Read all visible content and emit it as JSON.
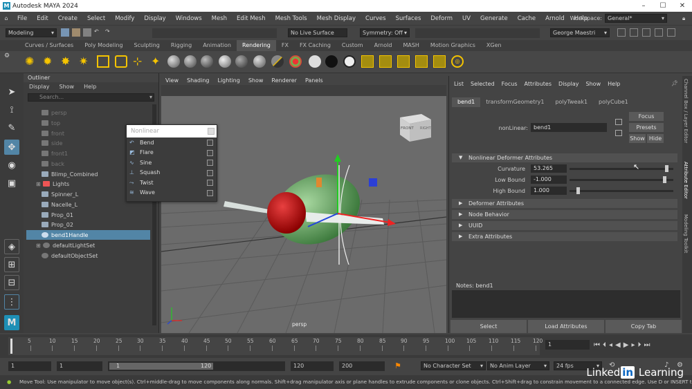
{
  "app": {
    "title": "Autodesk MAYA 2024",
    "logo": "M"
  },
  "menus": [
    "File",
    "Edit",
    "Create",
    "Select",
    "Modify",
    "Display",
    "Windows",
    "Mesh",
    "Edit Mesh",
    "Mesh Tools",
    "Mesh Display",
    "Curves",
    "Surfaces",
    "Deform",
    "UV",
    "Generate",
    "Cache",
    "Arnold",
    "Help"
  ],
  "workspace": {
    "label": "Workspace:",
    "value": "General*"
  },
  "status": {
    "mode": "Modeling",
    "live": "No Live Surface",
    "symmetry": "Symmetry: Off",
    "user": "George Maestri"
  },
  "shelf_tabs": [
    "Curves / Surfaces",
    "Poly Modeling",
    "Sculpting",
    "Rigging",
    "Animation",
    "Rendering",
    "FX",
    "FX Caching",
    "Custom",
    "Arnold",
    "MASH",
    "Motion Graphics",
    "XGen"
  ],
  "shelf_active": "Rendering",
  "outliner": {
    "title": "Outliner",
    "menu": [
      "Display",
      "Show",
      "Help"
    ],
    "search_placeholder": "Search...",
    "items": [
      {
        "label": "persp",
        "dim": true
      },
      {
        "label": "top",
        "dim": true
      },
      {
        "label": "front",
        "dim": true
      },
      {
        "label": "side",
        "dim": true
      },
      {
        "label": "front1",
        "dim": true
      },
      {
        "label": "back",
        "dim": true
      },
      {
        "label": "Blimp_Combined",
        "dim": false
      },
      {
        "label": "Lights",
        "dim": false
      },
      {
        "label": "Spinner_L",
        "dim": false
      },
      {
        "label": "Nacelle_L",
        "dim": false
      },
      {
        "label": "Prop_01",
        "dim": false
      },
      {
        "label": "Prop_02",
        "dim": false
      },
      {
        "label": "bend1Handle",
        "dim": false,
        "selected": true
      },
      {
        "label": "defaultLightSet",
        "dim": false
      },
      {
        "label": "defaultObjectSet",
        "dim": false
      }
    ]
  },
  "viewport": {
    "menu": [
      "View",
      "Shading",
      "Lighting",
      "Show",
      "Renderer",
      "Panels"
    ],
    "camera": "persp",
    "cube_front": "FRONT",
    "cube_right": "RIGHT"
  },
  "nonlinear_menu": {
    "title": "Nonlinear",
    "items": [
      "Bend",
      "Flare",
      "Sine",
      "Squash",
      "Twist",
      "Wave"
    ]
  },
  "attribute_editor": {
    "menu": [
      "List",
      "Selected",
      "Focus",
      "Attributes",
      "Display",
      "Show",
      "Help"
    ],
    "tabs": [
      "bend1",
      "transformGeometry1",
      "polyTweak1",
      "polyCube1"
    ],
    "node_label": "nonLinear:",
    "node_value": "bend1",
    "buttons": {
      "focus": "Focus",
      "presets": "Presets",
      "show": "Show",
      "hide": "Hide"
    },
    "section_main": "Nonlinear Deformer Attributes",
    "fields": [
      {
        "label": "Curvature",
        "value": "53.265",
        "slider": 0.95
      },
      {
        "label": "Low Bound",
        "value": "-1.000",
        "slider": 0.93
      },
      {
        "label": "High Bound",
        "value": "1.000",
        "slider": 0.07
      }
    ],
    "sections": [
      "Deformer Attributes",
      "Node Behavior",
      "UUID",
      "Extra Attributes"
    ],
    "notes": "Notes:  bend1",
    "bottom_buttons": [
      "Select",
      "Load Attributes",
      "Copy Tab"
    ]
  },
  "side_tabs": [
    "Channel Box / Layer Editor",
    "Attribute Editor",
    "Modeling Toolkit"
  ],
  "timeline": {
    "ticks": [
      "5",
      "10",
      "15",
      "20",
      "25",
      "30",
      "35",
      "40",
      "45",
      "50",
      "55",
      "60",
      "65",
      "70",
      "75",
      "80",
      "85",
      "90",
      "95",
      "100",
      "105",
      "110",
      "115",
      "120"
    ],
    "current_frame": "1"
  },
  "range": {
    "start": "1",
    "start2": "1",
    "inner_start": "1",
    "inner_end": "120",
    "end": "120",
    "end2": "200",
    "character": "No Character Set",
    "anim_layer": "No Anim Layer",
    "fps": "24 fps"
  },
  "help": "Move Tool: Use manipulator to move object(s). Ctrl+middle-drag to move components along normals. Shift+drag manipulator axis or plane handles to extrude components or clone objects. Ctrl+Shift+drag to constrain movement to a connected edge. Use D or INSERT to change the pivot position",
  "watermark": {
    "a": "Linked",
    "b": "in",
    "c": " Learning"
  }
}
